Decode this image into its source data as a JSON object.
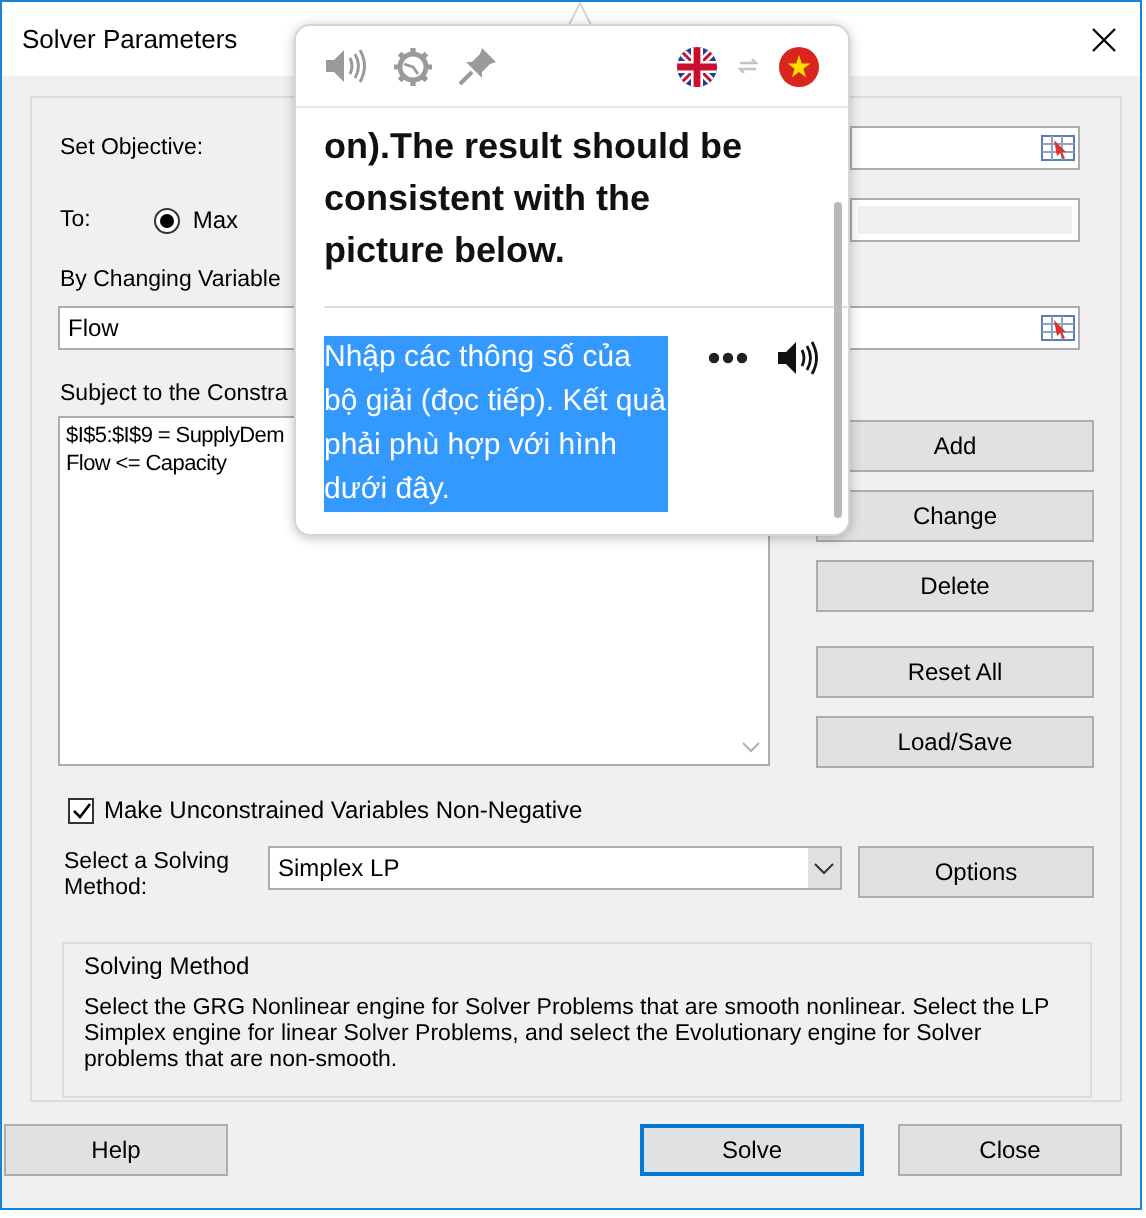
{
  "window": {
    "title": "Solver Parameters"
  },
  "objective": {
    "label": "Set Objective:"
  },
  "to": {
    "label": "To:",
    "options": [
      {
        "label": "Max",
        "selected": true
      }
    ]
  },
  "variables": {
    "label": "By Changing Variable",
    "value": "Flow"
  },
  "constraints": {
    "label": "Subject to the Constra",
    "items": [
      "$I$5:$I$9 = SupplyDem",
      "Flow <= Capacity"
    ]
  },
  "constraint_buttons": [
    [
      "Add",
      "Change",
      "Delete"
    ],
    [
      "Reset All",
      "Load/Save"
    ]
  ],
  "nonnegative": {
    "label": "Make Unconstrained Variables Non-Negative",
    "checked": true
  },
  "method": {
    "label": "Select a Solving Method:",
    "value": "Simplex LP",
    "options_button": "Options"
  },
  "method_info": {
    "title": "Solving Method",
    "text": "Select the GRG Nonlinear engine for Solver Problems that are smooth nonlinear. Select the LP Simplex engine for linear Solver Problems, and select the Evolutionary engine for Solver problems that are non-smooth."
  },
  "buttons": [
    {
      "label": "Help",
      "default": false
    },
    {
      "label": "Solve",
      "default": true
    },
    {
      "label": "Close",
      "default": false
    }
  ],
  "popup": {
    "source_text": "on).The result should be consistent with the picture below.",
    "translation": "Nhập các thông số của bộ giải (đọc tiếp). Kết quả phải phù hợp với hình dưới đây.",
    "translation_selected": true
  }
}
